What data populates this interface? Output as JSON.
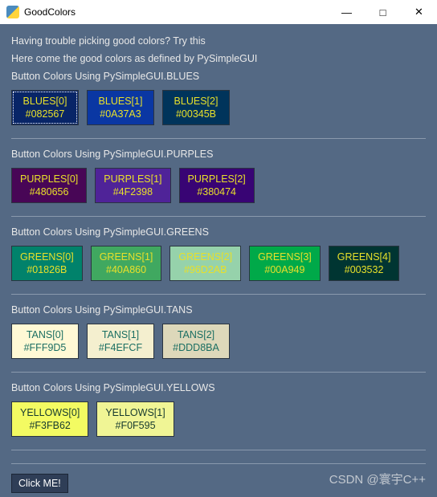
{
  "window": {
    "title": "GoodColors",
    "controls": {
      "min": "—",
      "max": "□",
      "close": "✕"
    }
  },
  "intro": {
    "line1": "Having trouble picking good colors? Try this",
    "line2": "Here come the good colors as defined by PySimpleGUI"
  },
  "sections": [
    {
      "title": "Button Colors Using PySimpleGUI.BLUES",
      "buttons": [
        {
          "label": "BLUES[0]",
          "hex": "#082567",
          "bg": "#082567",
          "fg": "#e8e02a",
          "focus": true
        },
        {
          "label": "BLUES[1]",
          "hex": "#0A37A3",
          "bg": "#0A37A3",
          "fg": "#e8e02a"
        },
        {
          "label": "BLUES[2]",
          "hex": "#00345B",
          "bg": "#00345B",
          "fg": "#e8e02a"
        }
      ]
    },
    {
      "title": "Button Colors Using PySimpleGUI.PURPLES",
      "buttons": [
        {
          "label": "PURPLES[0]",
          "hex": "#480656",
          "bg": "#480656",
          "fg": "#e8e02a"
        },
        {
          "label": "PURPLES[1]",
          "hex": "#4F2398",
          "bg": "#4F2398",
          "fg": "#e8e02a"
        },
        {
          "label": "PURPLES[2]",
          "hex": "#380474",
          "bg": "#380474",
          "fg": "#e8e02a"
        }
      ]
    },
    {
      "title": "Button Colors Using PySimpleGUI.GREENS",
      "buttons": [
        {
          "label": "GREENS[0]",
          "hex": "#01826B",
          "bg": "#01826B",
          "fg": "#e8e02a"
        },
        {
          "label": "GREENS[1]",
          "hex": "#40A860",
          "bg": "#40A860",
          "fg": "#e8e02a"
        },
        {
          "label": "GREENS[2]",
          "hex": "#96D2AB",
          "bg": "#96D2AB",
          "fg": "#e8e02a"
        },
        {
          "label": "GREENS[3]",
          "hex": "#00A949",
          "bg": "#00A949",
          "fg": "#e8e02a"
        },
        {
          "label": "GREENS[4]",
          "hex": "#003532",
          "bg": "#003532",
          "fg": "#e8e02a"
        }
      ]
    },
    {
      "title": "Button Colors Using PySimpleGUI.TANS",
      "buttons": [
        {
          "label": "TANS[0]",
          "hex": "#FFF9D5",
          "bg": "#FFF9D5",
          "fg": "#1a6e62"
        },
        {
          "label": "TANS[1]",
          "hex": "#F4EFCF",
          "bg": "#F4EFCF",
          "fg": "#1a6e62"
        },
        {
          "label": "TANS[2]",
          "hex": "#DDD8BA",
          "bg": "#DDD8BA",
          "fg": "#1a6e62"
        }
      ]
    },
    {
      "title": "Button Colors Using PySimpleGUI.YELLOWS",
      "buttons": [
        {
          "label": "YELLOWS[0]",
          "hex": "#F3FB62",
          "bg": "#F3FB62",
          "fg": "#173a2f"
        },
        {
          "label": "YELLOWS[1]",
          "hex": "#F0F595",
          "bg": "#F0F595",
          "fg": "#173a2f"
        }
      ]
    }
  ],
  "footer": {
    "button": "Click ME!"
  },
  "watermark": "CSDN @寰宇C++"
}
